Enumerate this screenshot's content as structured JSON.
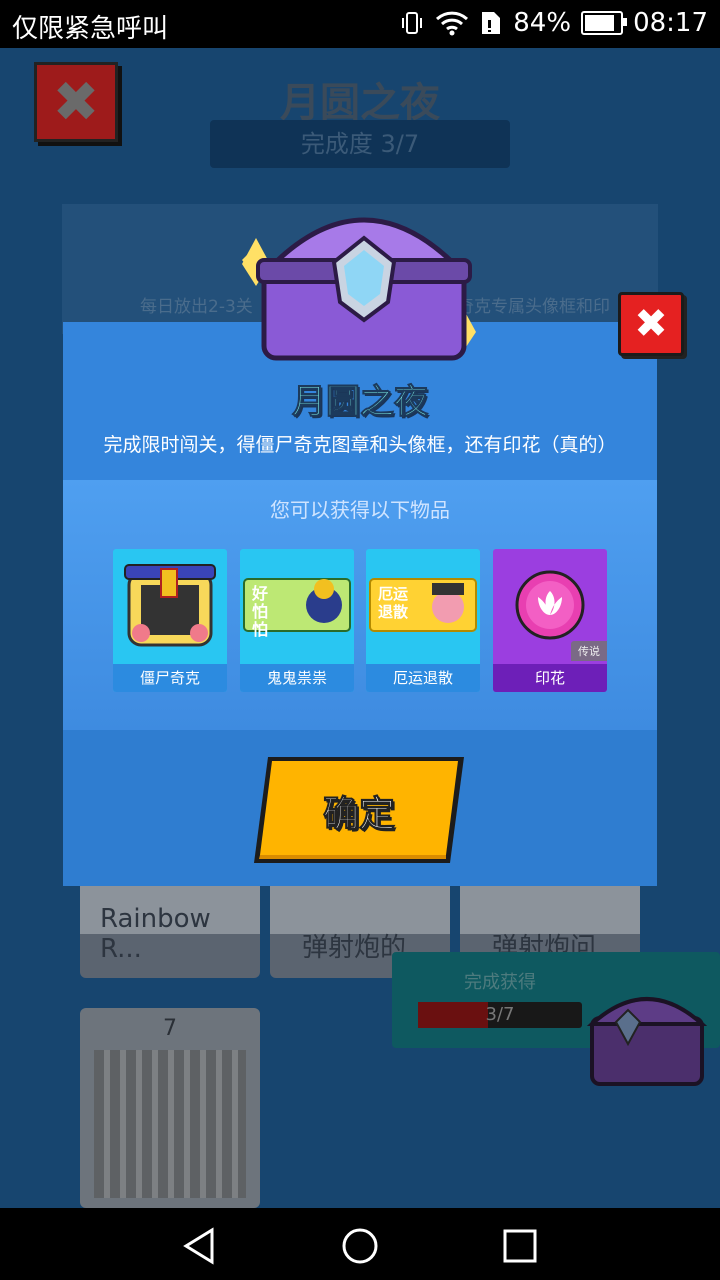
{
  "status_bar": {
    "carrier": "仅限紧急呼叫",
    "battery_percent": "84%",
    "battery_level": 0.84,
    "time": "08:17",
    "icons": [
      "vibrate-icon",
      "wifi-icon",
      "sim-icon",
      "battery-icon"
    ]
  },
  "background": {
    "title": "月圆之夜",
    "progress": "完成度 3/7",
    "banner_left": "每日放出2-3关",
    "banner_right": "尸奇克专属头像框和印",
    "levels": [
      "Rainbow R...",
      "弹射炮的",
      "弹射炮问"
    ],
    "level7_number": "7",
    "reward_title": "完成获得",
    "reward_progress": "3/7",
    "reward_fraction": 0.4286
  },
  "modal": {
    "title": "月圆之夜",
    "description": "完成限时闯关，得僵尸奇克图章和头像框，还有印花（真的）",
    "items_label": "您可以获得以下物品",
    "items": [
      {
        "name": "僵尸奇克",
        "bg": "#29c6f2",
        "label_bg": "#2c8be0"
      },
      {
        "name": "鬼鬼祟祟",
        "bg": "#29c6f2",
        "label_bg": "#2c8be0",
        "art_text": "好怕怕"
      },
      {
        "name": "厄运退散",
        "bg": "#29c6f2",
        "label_bg": "#2c8be0",
        "art_text": "厄运退散"
      },
      {
        "name": "印花",
        "bg": "#9b3ee0",
        "label_bg": "#6d1fb8",
        "tag": "传说"
      }
    ],
    "confirm_label": "确定",
    "accent_yellow": "#ffb400"
  },
  "nav": {
    "icons": [
      "back-icon",
      "home-icon",
      "recents-icon"
    ]
  }
}
